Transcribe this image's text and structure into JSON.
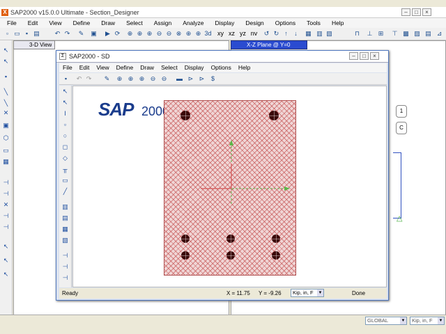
{
  "main_window": {
    "title": "SAP2000 v15.0.0 Ultimate  - Section_Designer",
    "menu": [
      "File",
      "Edit",
      "View",
      "Define",
      "Draw",
      "Select",
      "Assign",
      "Analyze",
      "Display",
      "Design",
      "Options",
      "Tools",
      "Help"
    ],
    "toolbar_text": [
      "3d",
      "xy",
      "xz",
      "yz",
      "nv"
    ],
    "view_3d_tab": "3-D View",
    "view_xz_tab": "X-Z Plane @ Y=0",
    "status": {
      "coord_system": "GLOBAL",
      "units": "Kip, in, F"
    }
  },
  "sd_window": {
    "title": "SAP2000 - SD",
    "menu": [
      "File",
      "Edit",
      "View",
      "Define",
      "Draw",
      "Select",
      "Display",
      "Options",
      "Help"
    ],
    "logo_sap": "SAP",
    "logo_2000": "2000",
    "status": {
      "ready": "Ready",
      "x": "X = 11.75",
      "y": "Y = -9.26",
      "units": "Kip, in, F",
      "done": "Done"
    }
  },
  "icons": {
    "app": "sap2000-logo-icon",
    "minimize": "minimize-icon",
    "maximize": "maximize-icon",
    "close": "close-icon"
  },
  "colors": {
    "section_fill": "#f0d6d6",
    "section_hatch": "#be3c3c",
    "rebar": "#3a0808",
    "axis_x": "#5ab848",
    "axis_y": "#5ab848",
    "logo": "#1a3c8c",
    "xz_tab": "#2a4bd0"
  }
}
